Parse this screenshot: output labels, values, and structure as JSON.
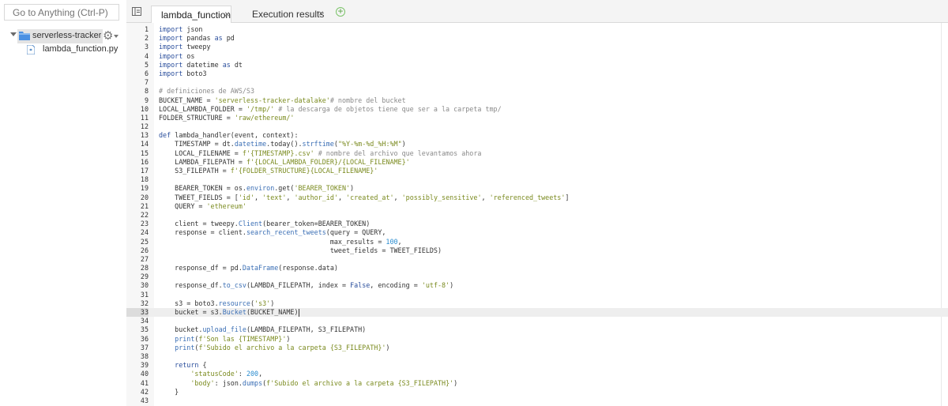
{
  "sidebar": {
    "goto_placeholder": "Go to Anything (Ctrl-P)",
    "root_folder": "serverless-tracker-t",
    "file": "lambda_function.py"
  },
  "tabs": [
    {
      "label": "lambda_function",
      "active": true,
      "close": "×"
    },
    {
      "label": "Execution results",
      "active": false,
      "close": "×"
    }
  ],
  "add_tab_symbol": "+",
  "colors": {
    "keyword": "#2a4e9c",
    "string": "#7a8a1e",
    "comment": "#8a8a8a",
    "folder": "#4a90e2"
  },
  "editor": {
    "active_line": 33,
    "lines": [
      "import json",
      "import pandas as pd",
      "import tweepy",
      "import os",
      "import datetime as dt",
      "import boto3",
      "",
      "# definiciones de AWS/S3",
      "BUCKET_NAME = 'serverless-tracker-datalake'# nombre del bucket",
      "LOCAL_LAMBDA_FOLDER = '/tmp/' # la descarga de objetos tiene que ser a la carpeta tmp/",
      "FOLDER_STRUCTURE = 'raw/ethereum/'",
      "",
      "def lambda_handler(event, context):",
      "    TIMESTAMP = dt.datetime.today().strftime(\"%Y-%m-%d_%H:%M\")",
      "    LOCAL_FILENAME = f'{TIMESTAMP}.csv' # nombre del archivo que levantamos ahora",
      "    LAMBDA_FILEPATH = f'{LOCAL_LAMBDA_FOLDER}/{LOCAL_FILENAME}'",
      "    S3_FILEPATH = f'{FOLDER_STRUCTURE}{LOCAL_FILENAME}'",
      "",
      "    BEARER_TOKEN = os.environ.get('BEARER_TOKEN')",
      "    TWEET_FIELDS = ['id', 'text', 'author_id', 'created_at', 'possibly_sensitive', 'referenced_tweets']",
      "    QUERY = 'ethereum'",
      "",
      "    client = tweepy.Client(bearer_token=BEARER_TOKEN)",
      "    response = client.search_recent_tweets(query = QUERY,",
      "                                           max_results = 100,",
      "                                           tweet_fields = TWEET_FIELDS)",
      "",
      "    response_df = pd.DataFrame(response.data)",
      "",
      "    response_df.to_csv(LAMBDA_FILEPATH, index = False, encoding = 'utf-8')",
      "",
      "    s3 = boto3.resource('s3')",
      "    bucket = s3.Bucket(BUCKET_NAME)",
      "",
      "    bucket.upload_file(LAMBDA_FILEPATH, S3_FILEPATH)",
      "    print(f'Son las {TIMESTAMP}')",
      "    print(f'Subido el archivo a la carpeta {S3_FILEPATH}')",
      "",
      "    return {",
      "        'statusCode': 200,",
      "        'body': json.dumps(f'Subido el archivo a la carpeta {S3_FILEPATH}')",
      "    }",
      ""
    ]
  }
}
